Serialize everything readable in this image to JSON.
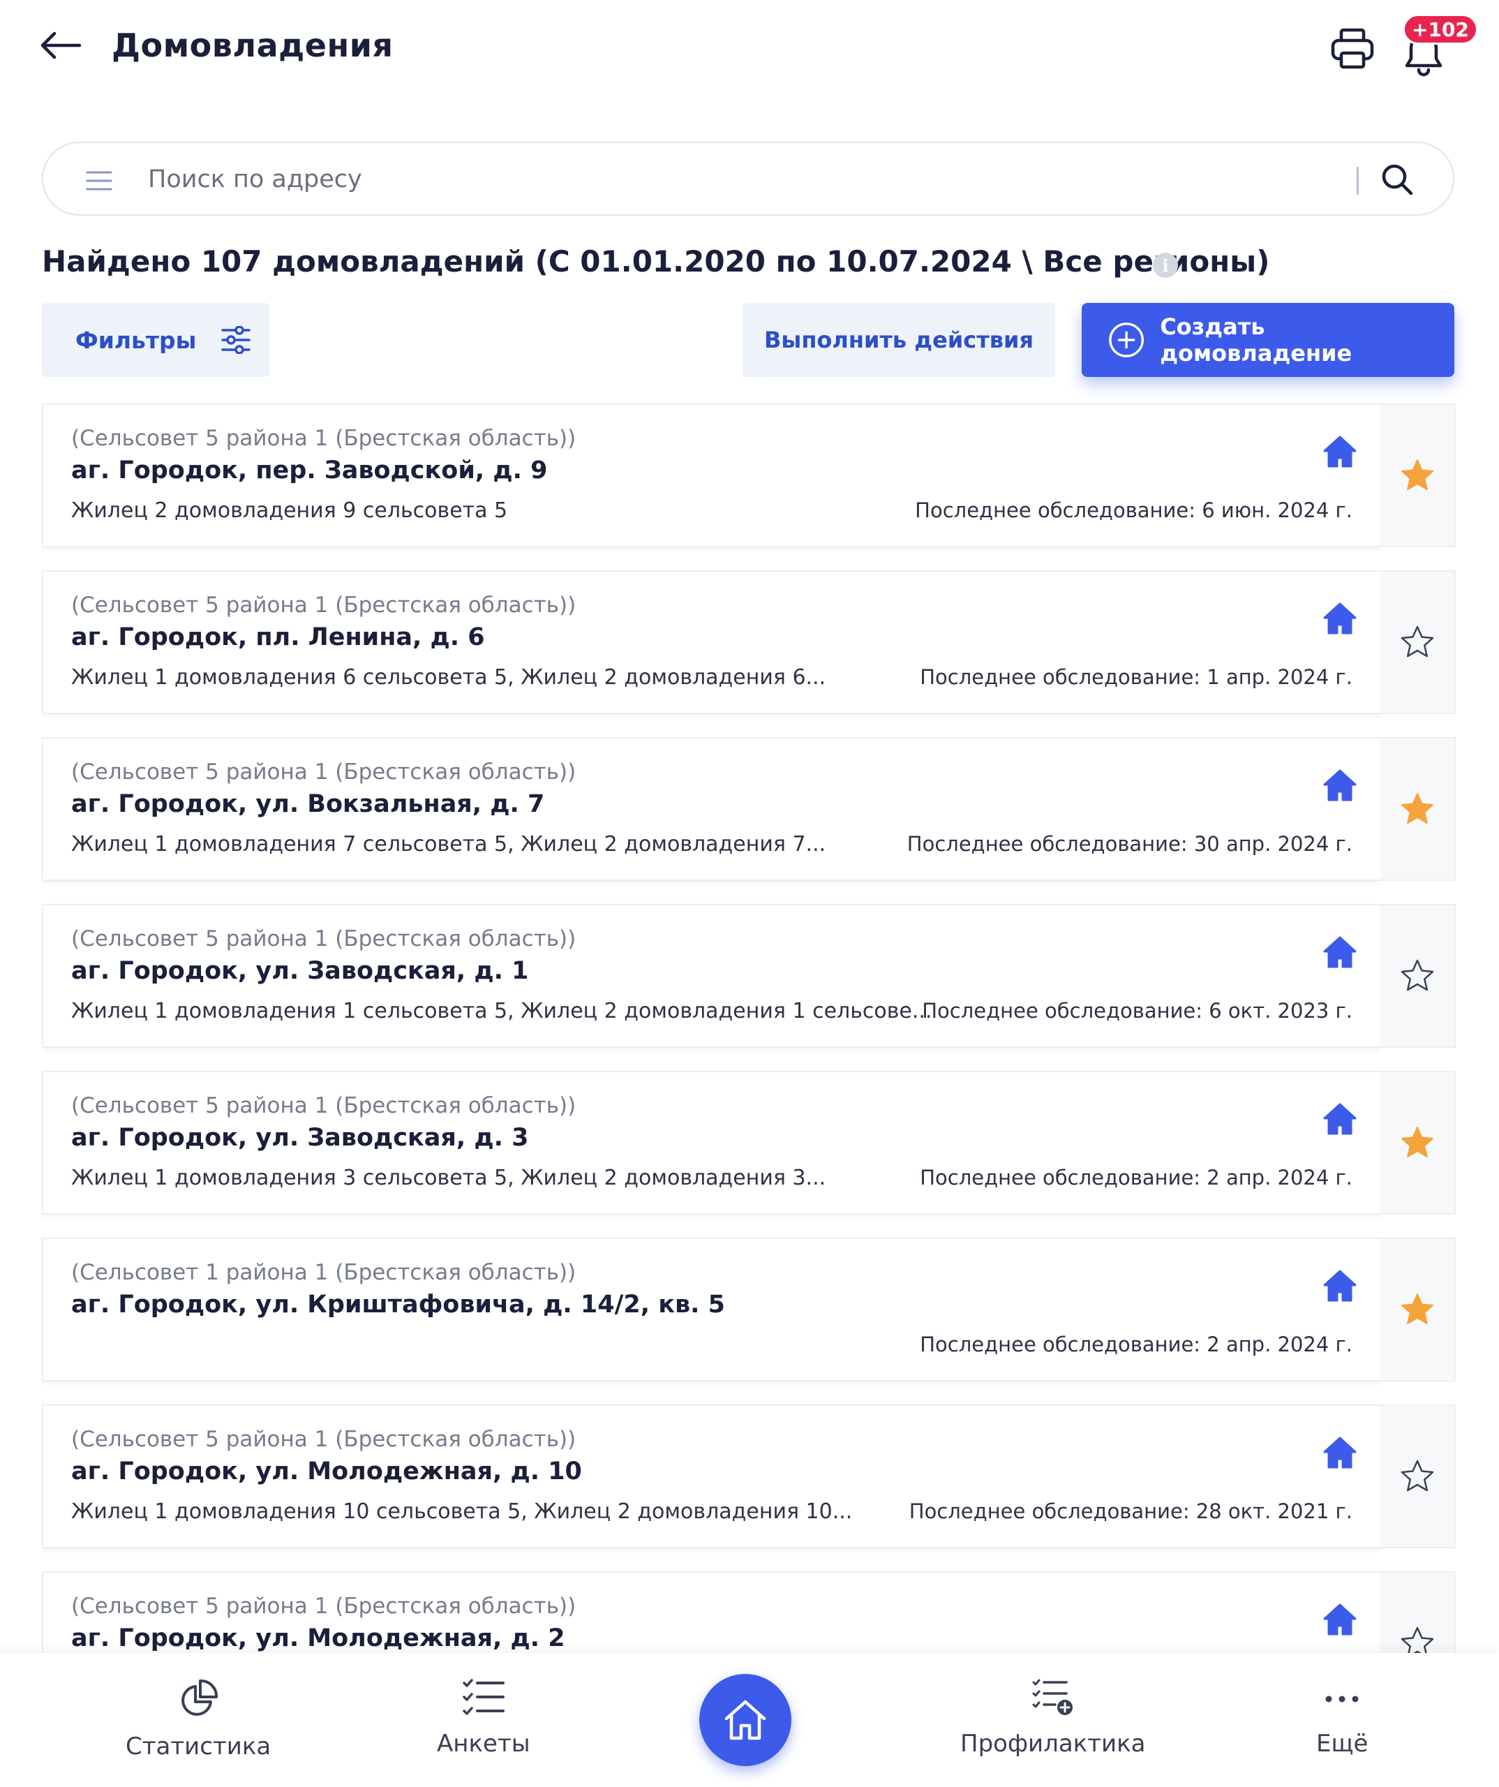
{
  "header": {
    "title": "Домовладения",
    "notification_badge": "+102"
  },
  "search": {
    "placeholder": "Поиск по адресу"
  },
  "results_summary": "Найдено 107 домовладений (С 01.01.2020 по 10.07.2024 \\ Все регионы)",
  "toolbar": {
    "filters_label": "Фильтры",
    "actions_label": "Выполнить действия",
    "create_label": "Создать домовладение"
  },
  "colors": {
    "accent": "#3d5bea",
    "star_active": "#f5a33a",
    "badge": "#e8254e"
  },
  "households": [
    {
      "org": "(Сельсовет 5 района 1 (Брестская область))",
      "address": "аг. Городок, пер. Заводской, д. 9",
      "residents": "Жилец 2 домовладения 9 сельсовета 5",
      "last_survey": "Последнее обследование: 6 июн. 2024 г.",
      "favorite": true
    },
    {
      "org": "(Сельсовет 5 района 1 (Брестская область))",
      "address": "аг. Городок, пл. Ленина, д. 6",
      "residents": "Жилец 1 домовладения 6 сельсовета 5, Жилец 2 домовладения 6...",
      "last_survey": "Последнее обследование: 1 апр. 2024 г.",
      "favorite": false
    },
    {
      "org": "(Сельсовет 5 района 1 (Брестская область))",
      "address": "аг. Городок, ул. Вокзальная, д. 7",
      "residents": "Жилец 1 домовладения 7 сельсовета 5, Жилец 2 домовладения 7...",
      "last_survey": "Последнее обследование: 30 апр. 2024 г.",
      "favorite": true
    },
    {
      "org": "(Сельсовет 5 района 1 (Брестская область))",
      "address": "аг. Городок, ул. Заводская, д. 1",
      "residents": "Жилец 1 домовладения 1 сельсовета 5, Жилец 2 домовладения 1 сельсове...",
      "last_survey": "Последнее обследование: 6 окт. 2023 г.",
      "favorite": false
    },
    {
      "org": "(Сельсовет 5 района 1 (Брестская область))",
      "address": "аг. Городок, ул. Заводская, д. 3",
      "residents": "Жилец 1 домовладения 3 сельсовета 5, Жилец 2 домовладения 3...",
      "last_survey": "Последнее обследование: 2 апр. 2024 г.",
      "favorite": true
    },
    {
      "org": "(Сельсовет 1 района 1 (Брестская область))",
      "address": "аг. Городок, ул. Криштафовича, д. 14/2, кв. 5",
      "residents": "",
      "last_survey": "Последнее обследование: 2 апр. 2024 г.",
      "favorite": true
    },
    {
      "org": "(Сельсовет 5 района 1 (Брестская область))",
      "address": "аг. Городок, ул. Молодежная, д. 10",
      "residents": "Жилец 1 домовладения 10 сельсовета 5, Жилец 2 домовладения 10...",
      "last_survey": "Последнее обследование: 28 окт. 2021 г.",
      "favorite": false
    },
    {
      "org": "(Сельсовет 5 района 1 (Брестская область))",
      "address": "аг. Городок, ул. Молодежная, д. 2",
      "residents": "",
      "last_survey": "",
      "favorite": false
    }
  ],
  "bottom_nav": {
    "statistics": "Статистика",
    "questionnaires": "Анкеты",
    "prevention": "Профилактика",
    "more": "Ещё"
  }
}
